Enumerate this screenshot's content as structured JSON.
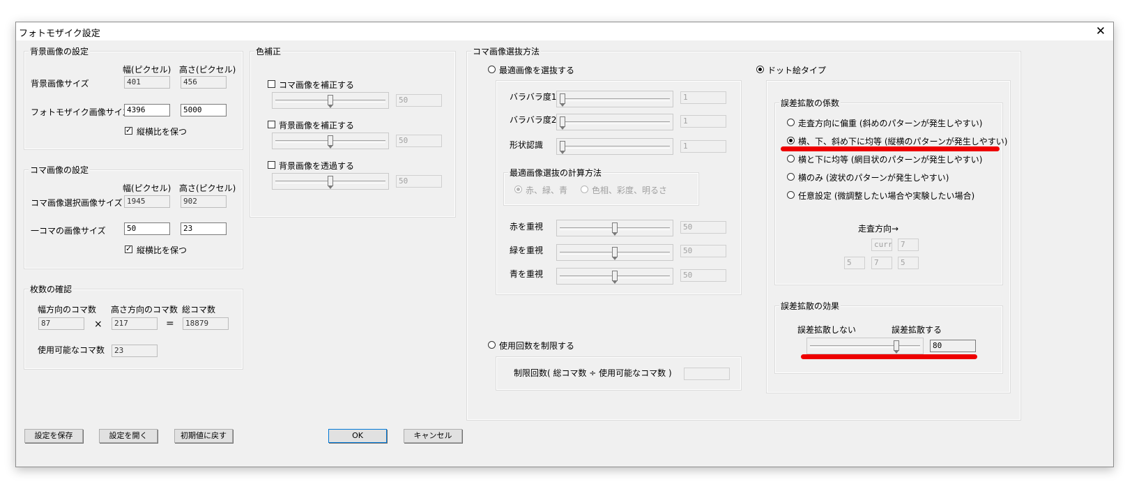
{
  "window": {
    "title": "フォトモザイク設定",
    "close_glyph": "✕"
  },
  "bg_settings": {
    "title": "背景画像の設定",
    "col_width": "幅(ピクセル)",
    "col_height": "高さ(ピクセル)",
    "bg_size_label": "背景画像サイズ",
    "bg_width": "401",
    "bg_height": "456",
    "mosaic_size_label": "フォトモザイク画像サイズ",
    "mosaic_width": "4396",
    "mosaic_height": "5000",
    "keep_ratio_label": "縦横比を保つ",
    "keep_ratio_checked": true
  },
  "tile_settings": {
    "title": "コマ画像の設定",
    "col_width": "幅(ピクセル)",
    "col_height": "高さ(ピクセル)",
    "select_size_label": "コマ画像選択画像サイズ",
    "select_width": "1945",
    "select_height": "902",
    "tile_size_label": "一コマの画像サイズ",
    "tile_width": "50",
    "tile_height": "23",
    "keep_ratio_label": "縦横比を保つ",
    "keep_ratio_checked": true
  },
  "count_check": {
    "title": "枚数の確認",
    "horiz_label": "幅方向のコマ数",
    "vert_label": "高さ方向のコマ数",
    "total_label": "総コマ数",
    "horiz_value": "87",
    "times": "×",
    "vert_value": "217",
    "equals": "=",
    "total_value": "18879",
    "usable_label": "使用可能なコマ数",
    "usable_value": "23"
  },
  "color_correction": {
    "title": "色補正",
    "items": [
      {
        "label": "コマ画像を補正する",
        "checked": false,
        "value": "50",
        "level": 0.5
      },
      {
        "label": "背景画像を補正する",
        "checked": false,
        "value": "50",
        "level": 0.5
      },
      {
        "label": "背景画像を透過する",
        "checked": false,
        "value": "50",
        "level": 0.5
      }
    ]
  },
  "selection": {
    "title": "コマ画像選抜方法",
    "best_label": "最適画像を選抜する",
    "dot_label": "ドット絵タイプ",
    "mode": "dot",
    "variation1_label": "バラバラ度1",
    "variation1_value": "1",
    "variation1_level": 0,
    "variation2_label": "バラバラ度2",
    "variation2_value": "1",
    "variation2_level": 0,
    "shape_label": "形状認識",
    "shape_value": "1",
    "shape_level": 0,
    "calc_title": "最適画像選抜の計算方法",
    "calc_rgb": "赤、緑、青",
    "calc_hsv": "色相、彩度、明るさ",
    "red_label": "赤を重視",
    "red_value": "50",
    "red_level": 0.5,
    "green_label": "緑を重視",
    "green_value": "50",
    "green_level": 0.5,
    "blue_label": "青を重視",
    "blue_value": "50",
    "blue_level": 0.5,
    "limit_label": "使用回数を制限する",
    "limit_formula": "制限回数( 総コマ数 ÷ 使用可能なコマ数 )",
    "limit_value": ""
  },
  "diffusion": {
    "coef_title": "誤差拡散の係数",
    "options": [
      "走査方向に偏重 (斜めのパターンが発生しやすい)",
      "横、下、斜め下に均等 (縦横のパターンが発生しやすい)",
      "横と下に均等 (網目状のパターンが発生しやすい)",
      "横のみ (波状のパターンが発生しやすい)",
      "任意設定 (微調整したい場合や実験したい場合)"
    ],
    "selected_index": 1,
    "scan_dir_label": "走査方向→",
    "curr": "curr",
    "right": "7",
    "bottom_left": "5",
    "bottom": "7",
    "bottom_right": "5",
    "effect_title": "誤差拡散の効果",
    "effect_min_label": "誤差拡散しない",
    "effect_max_label": "誤差拡散する",
    "effect_value": "80",
    "effect_level": 0.8
  },
  "buttons": {
    "save": "設定を保存",
    "open": "設定を開く",
    "reset": "初期値に戻す",
    "ok": "OK",
    "cancel": "キャンセル"
  },
  "colors": {
    "annotation": "#ee0000",
    "dialog_bg": "#f0f0f0"
  }
}
